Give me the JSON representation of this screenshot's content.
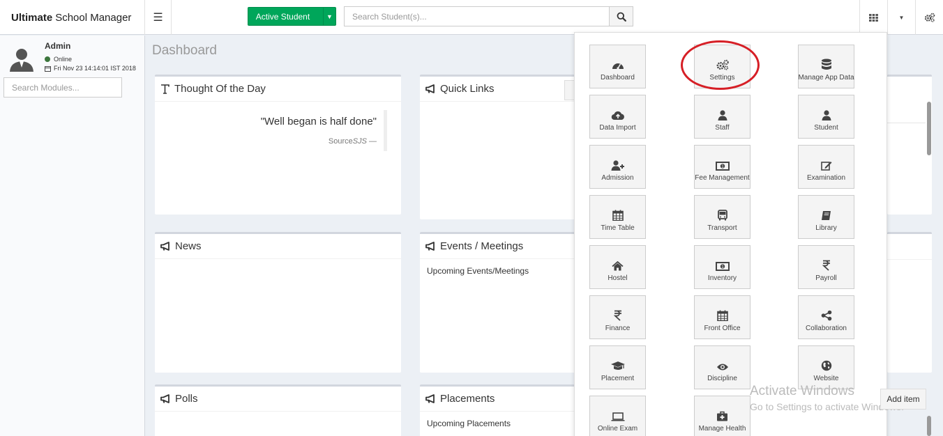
{
  "app": {
    "brand_bold": "Ultimate",
    "brand_rest": "School Manager"
  },
  "topbar": {
    "active_button": "Active Student",
    "search_placeholder": "Search Student(s)..."
  },
  "user": {
    "name": "Admin",
    "status": "Online",
    "datetime": "Fri Nov 23 14:14:01 IST 2018"
  },
  "sidebar": {
    "search_placeholder": "Search Modules..."
  },
  "page": {
    "title": "Dashboard"
  },
  "panels": {
    "thought": {
      "title": "Thought Of the Day",
      "quote": "\"Well began is half done\"",
      "source": "Source",
      "source_author": "SJS —"
    },
    "quick_links": {
      "title": "Quick Links"
    },
    "news": {
      "title": "News"
    },
    "events": {
      "title": "Events / Meetings",
      "subtitle": "Upcoming Events/Meetings"
    },
    "polls": {
      "title": "Polls"
    },
    "placements": {
      "title": "Placements",
      "subtitle": "Upcoming Placements"
    }
  },
  "menu": [
    {
      "label": "Dashboard",
      "icon": "dashboard-icon"
    },
    {
      "label": "Settings",
      "icon": "gears-icon"
    },
    {
      "label": "Manage App Data",
      "icon": "database-icon"
    },
    {
      "label": "Data Import",
      "icon": "cloud-upload-icon"
    },
    {
      "label": "Staff",
      "icon": "user-icon"
    },
    {
      "label": "Student",
      "icon": "user-icon"
    },
    {
      "label": "Admission",
      "icon": "user-plus-icon"
    },
    {
      "label": "Fee Management",
      "icon": "money-icon"
    },
    {
      "label": "Examination",
      "icon": "edit-icon"
    },
    {
      "label": "Time Table",
      "icon": "calendar-icon"
    },
    {
      "label": "Transport",
      "icon": "bus-icon"
    },
    {
      "label": "Library",
      "icon": "book-icon"
    },
    {
      "label": "Hostel",
      "icon": "home-icon"
    },
    {
      "label": "Inventory",
      "icon": "money-icon"
    },
    {
      "label": "Payroll",
      "icon": "rupee-icon"
    },
    {
      "label": "Finance",
      "icon": "rupee-icon"
    },
    {
      "label": "Front Office",
      "icon": "calendar-icon"
    },
    {
      "label": "Collaboration",
      "icon": "share-icon"
    },
    {
      "label": "Placement",
      "icon": "graduation-cap-icon"
    },
    {
      "label": "Discipline",
      "icon": "eye-icon"
    },
    {
      "label": "Website",
      "icon": "globe-icon"
    },
    {
      "label": "Online Exam",
      "icon": "laptop-icon"
    },
    {
      "label": "Manage Health",
      "icon": "medkit-icon"
    }
  ],
  "overlay": {
    "watermark_title": "Activate Windows",
    "watermark_sub": "Go to Settings to activate Windows.",
    "add_item": "Add item"
  }
}
